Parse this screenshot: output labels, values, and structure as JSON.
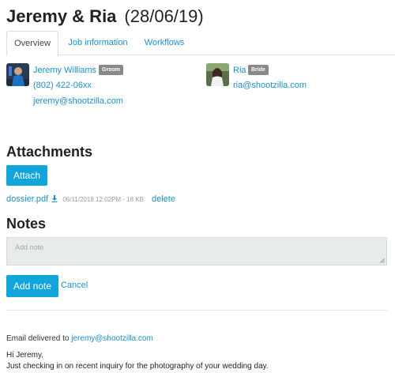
{
  "header": {
    "title": "Jeremy & Ria",
    "date": "(28/06/19)"
  },
  "tabs": [
    {
      "label": "Overview",
      "active": true
    },
    {
      "label": "Job information",
      "active": false
    },
    {
      "label": "Workflows",
      "active": false
    }
  ],
  "contacts": [
    {
      "name": "Jeremy Williams",
      "role": "Groom",
      "phone": "(802) 422-06xx",
      "email": "jeremy@shootzilla.com"
    },
    {
      "name": "Ria",
      "role": "Bride",
      "email": "ria@shootzilla.com"
    }
  ],
  "attachments": {
    "heading": "Attachments",
    "attach_label": "Attach",
    "files": [
      {
        "name": "dossier.pdf",
        "meta": "06/11/2018 12:02PM - 18 KB",
        "delete_label": "delete"
      }
    ]
  },
  "notes": {
    "heading": "Notes",
    "placeholder": "Add note",
    "add_label": "Add note",
    "cancel_label": "Cancel"
  },
  "email": {
    "prefix": "Email delivered to",
    "address": "jeremy@shootzilla.com",
    "greeting": "Hi Jeremy,",
    "body": "Just checking in on recent inquiry for the photography of your wedding day."
  },
  "colors": {
    "link": "#1a8fc9",
    "button": "#12a5dc",
    "badge": "#888888",
    "notes_bg": "#e8ebec"
  }
}
